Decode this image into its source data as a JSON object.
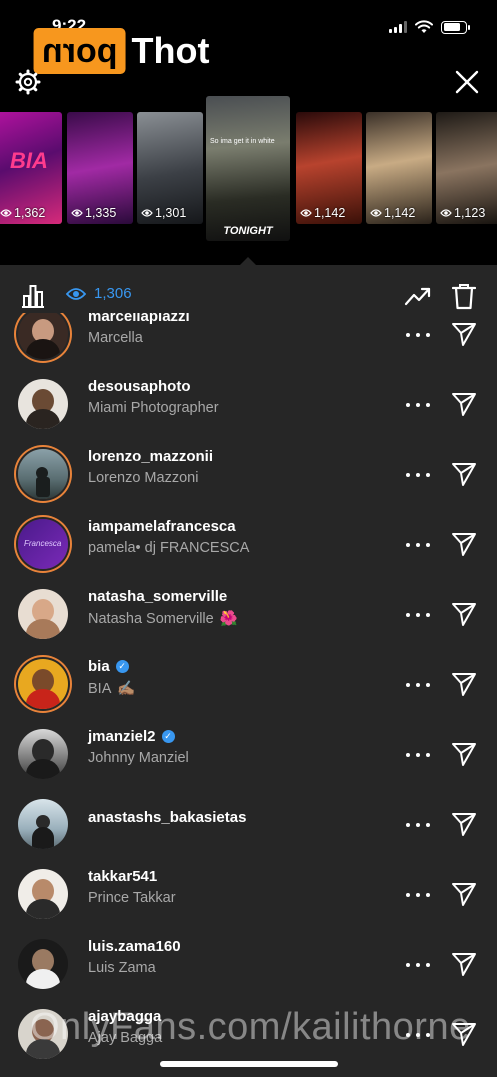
{
  "status": {
    "time": "9:22"
  },
  "watermark": {
    "logo_box": "porn",
    "logo_text": "Thot",
    "footer": "OnlyFans.com/kailithorne"
  },
  "stories": [
    {
      "views": "1,362",
      "overlay": "BIA",
      "active": false
    },
    {
      "views": "1,335",
      "active": false
    },
    {
      "views": "1,301",
      "active": false
    },
    {
      "views": "",
      "caption": "So ima get it in white",
      "overlay": "TONIGHT",
      "active": true
    },
    {
      "views": "1,142",
      "active": false
    },
    {
      "views": "1,142",
      "active": false
    },
    {
      "views": "1,123",
      "active": false
    }
  ],
  "toolbar": {
    "view_count": "1,306"
  },
  "viewers": [
    {
      "username": "marcellapiazzi",
      "name": "Marcella",
      "verified": false,
      "ring": true
    },
    {
      "username": "desousaphoto",
      "name": "Miami Photographer",
      "verified": false,
      "ring": false
    },
    {
      "username": "lorenzo_mazzonii",
      "name": "Lorenzo Mazzoni",
      "verified": false,
      "ring": true
    },
    {
      "username": "iampamelafrancesca",
      "name": "pamela• dj FRANCESCA",
      "verified": false,
      "ring": true
    },
    {
      "username": "natasha_somerville",
      "name": "Natasha Somerville",
      "emoji": "🌺",
      "verified": false,
      "ring": false
    },
    {
      "username": "bia",
      "name": "BIA",
      "emoji": "✍🏽",
      "verified": true,
      "ring": true
    },
    {
      "username": "jmanziel2",
      "name": "Johnny Manziel",
      "verified": true,
      "ring": false
    },
    {
      "username": "anastashs_bakasietas",
      "name": "",
      "verified": false,
      "ring": false
    },
    {
      "username": "takkar541",
      "name": "Prince Takkar",
      "verified": false,
      "ring": false
    },
    {
      "username": "luis.zama160",
      "name": "Luis Zama",
      "verified": false,
      "ring": false
    },
    {
      "username": "ajaybagga",
      "name": "Ajay Bagga",
      "verified": false,
      "ring": false
    }
  ],
  "colors": {
    "accent": "#3897f0",
    "panel": "#262626",
    "ring": "#e8833a",
    "watermark_orange": "#f7971e"
  }
}
